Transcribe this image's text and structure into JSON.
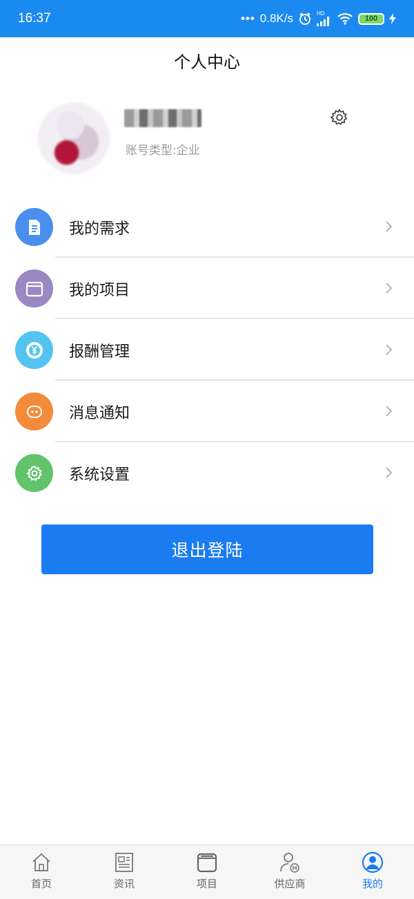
{
  "status_bar": {
    "time": "16:37",
    "network_speed": "0.8K/s",
    "hd_label": "HD",
    "battery": "100"
  },
  "header": {
    "title": "个人中心"
  },
  "profile": {
    "account_type": "账号类型:企业"
  },
  "menu": [
    {
      "label": "我的需求",
      "icon": "document-icon",
      "color": "#4a8ff0"
    },
    {
      "label": "我的项目",
      "icon": "folder-icon",
      "color": "#9a88c2"
    },
    {
      "label": "报酬管理",
      "icon": "yen-coin-icon",
      "color": "#53c4f0"
    },
    {
      "label": "消息通知",
      "icon": "chat-bubble-icon",
      "color": "#f38b3a"
    },
    {
      "label": "系统设置",
      "icon": "gear-icon",
      "color": "#62c36a"
    }
  ],
  "logout": {
    "label": "退出登陆"
  },
  "tabbar": {
    "items": [
      {
        "label": "首页",
        "icon": "home-icon",
        "active": false
      },
      {
        "label": "资讯",
        "icon": "news-icon",
        "active": false
      },
      {
        "label": "项目",
        "icon": "project-icon",
        "active": false
      },
      {
        "label": "供应商",
        "icon": "supplier-icon",
        "active": false
      },
      {
        "label": "我的",
        "icon": "profile-icon",
        "active": true
      }
    ],
    "active_color": "#1b7cf2"
  },
  "colors": {
    "status_bar": "#1b8af0",
    "primary": "#1b7cf2"
  }
}
